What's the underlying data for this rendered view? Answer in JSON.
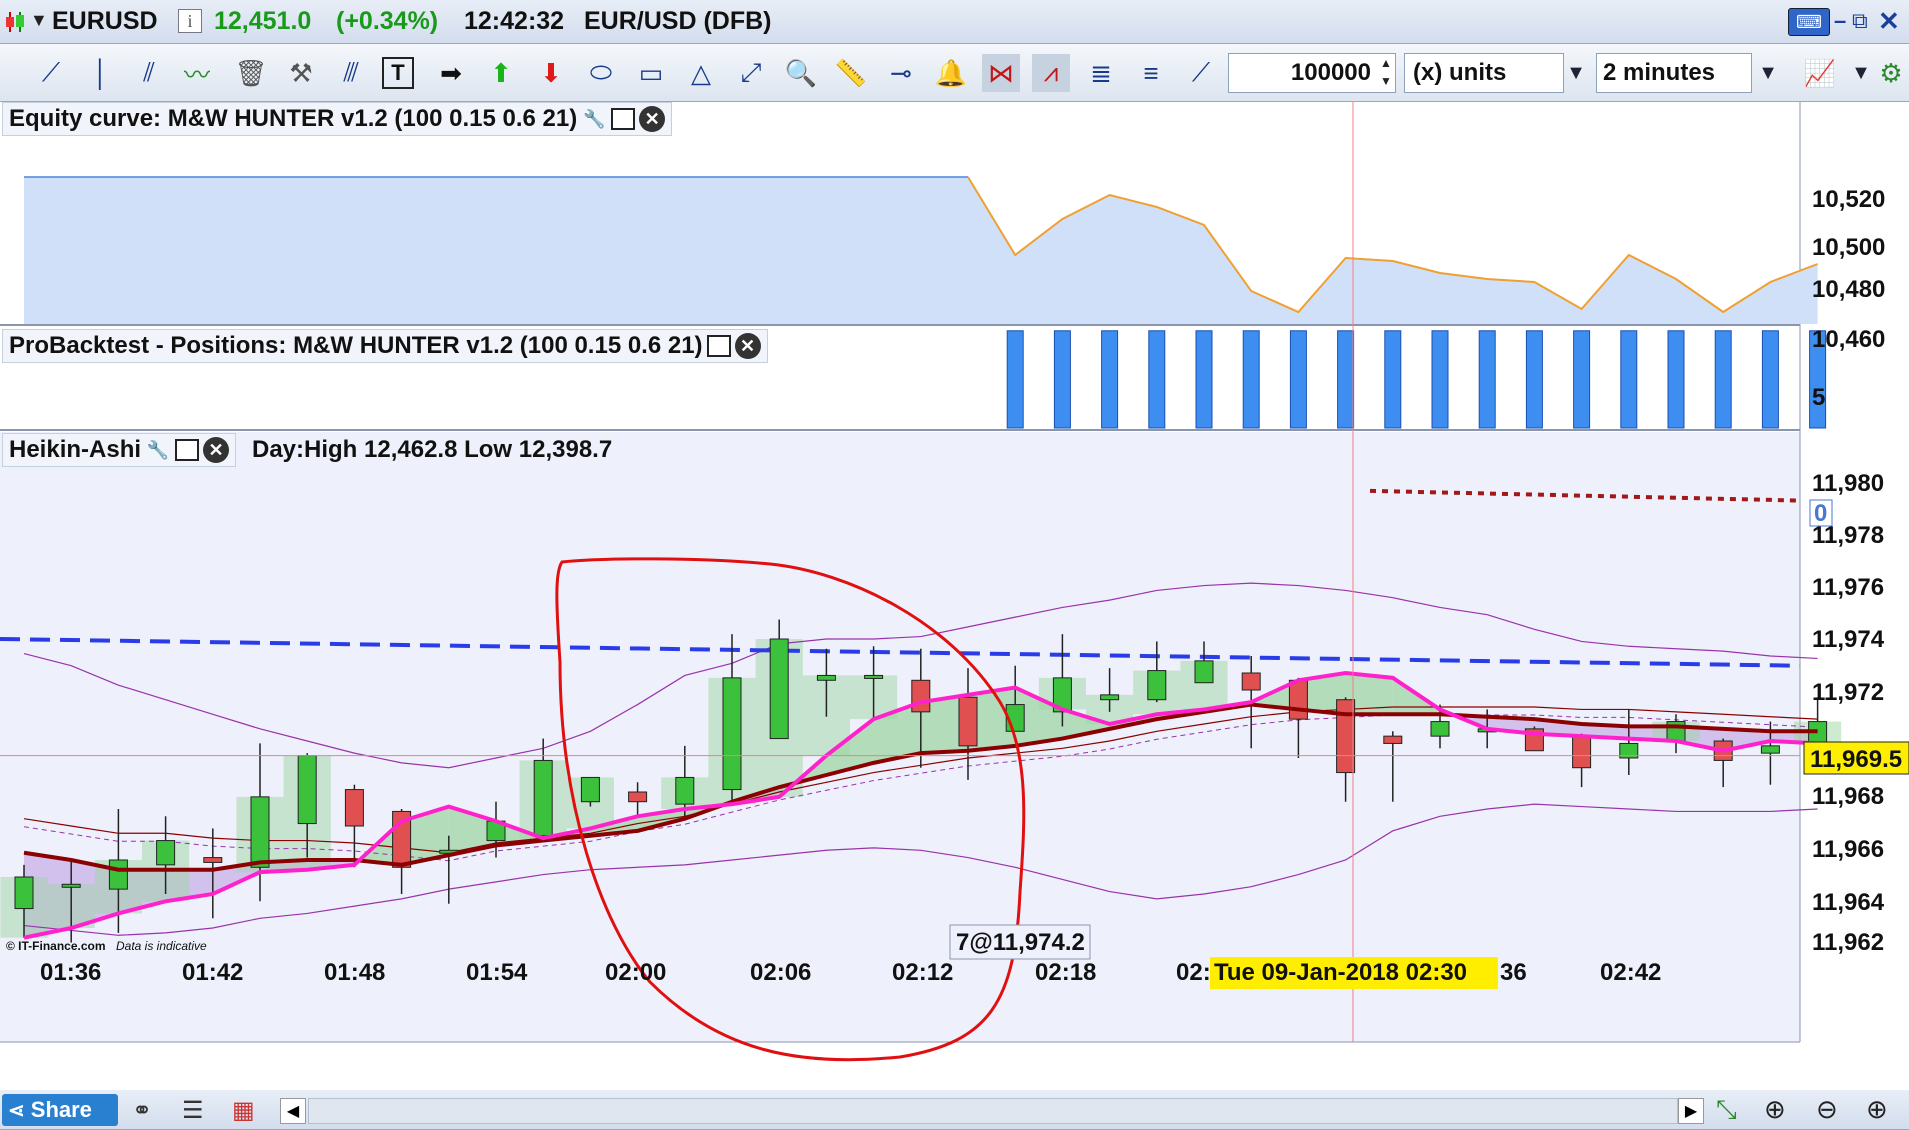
{
  "title_bar": {
    "symbol": "EURUSD",
    "price": "12,451.0",
    "change": "(+0.34%)",
    "time": "12:42:32",
    "instrument": "EUR/USD (DFB)"
  },
  "toolbar": {
    "quantity": "100000",
    "units_label": "(x) units",
    "timeframe": "2 minutes"
  },
  "equity_pane": {
    "title": "Equity curve: M&W HUNTER v1.2 (100 0.15 0.6 21)",
    "y_ticks": [
      "10,520",
      "10,500",
      "10,480",
      "10,460"
    ]
  },
  "positions_pane": {
    "title": "ProBacktest - Positions: M&W HUNTER v1.2 (100 0.15 0.6 21)",
    "y_ticks": [
      "5",
      "0"
    ]
  },
  "price_pane": {
    "title": "Heikin-Ashi",
    "day_range": "Day:High 12,462.8 Low 12,398.7",
    "y_ticks": [
      "11,980",
      "11,978",
      "11,976",
      "11,974",
      "11,972",
      "11,968",
      "11,966",
      "11,964",
      "11,962"
    ],
    "current_price_label": "11,969.5",
    "position_label": "7@11,974.2",
    "watermark": "© IT-Finance.com",
    "disclaimer": "Data is indicative"
  },
  "x_axis": {
    "ticks": [
      "01:36",
      "01:42",
      "01:48",
      "01:54",
      "02:00",
      "02:06",
      "02:12",
      "02:18",
      "02:"
    ],
    "ticks_right": [
      "36",
      "02:42"
    ],
    "cursor_label": "Tue 09-Jan-2018 02:30"
  },
  "bottom_bar": {
    "share_label": "Share"
  },
  "colors": {
    "bull": "#3cc13c",
    "bear": "#e05050",
    "pink_ma": "#ff22cc",
    "darkred_ma": "#8b0000",
    "blue_dash": "#2a3ce8",
    "bollinger": "#9933aa",
    "annotation": "#e01010",
    "cursor_bg": "#ffee00"
  },
  "chart_data": [
    {
      "type": "area",
      "name": "equity",
      "title": "Equity curve: M&W HUNTER v1.2 (100 0.15 0.6 21)",
      "ylim": [
        10451,
        10525
      ],
      "values": [
        10500,
        10500,
        10500,
        10500,
        10500,
        10500,
        10500,
        10500,
        10500,
        10500,
        10500,
        10500,
        10500,
        10500,
        10500,
        10500,
        10500,
        10500,
        10500,
        10500,
        10500,
        10474,
        10486,
        10494,
        10490,
        10484,
        10462,
        10455,
        10473,
        10472,
        10468,
        10466,
        10465,
        10456,
        10474,
        10466,
        10455,
        10465,
        10471
      ]
    },
    {
      "type": "bar",
      "name": "positions",
      "title": "ProBacktest - Positions: M&W HUNTER v1.2 (100 0.15 0.6 21)",
      "ylim": [
        0,
        7.2
      ],
      "start_index": 21,
      "values": [
        7,
        7,
        7,
        7,
        7,
        7,
        7,
        7,
        7,
        7,
        7,
        7,
        7,
        7,
        7,
        7,
        7,
        7
      ]
    },
    {
      "type": "candlestick",
      "name": "Heikin-Ashi",
      "ylim": [
        11961.0,
        11982.0
      ],
      "candles": [
        {
          "o": 11963.2,
          "h": 11965.0,
          "l": 11962.0,
          "c": 11964.5
        },
        {
          "o": 11964.2,
          "h": 11965.2,
          "l": 11961.8,
          "c": 11964.2
        },
        {
          "o": 11964.0,
          "h": 11967.3,
          "l": 11962.2,
          "c": 11965.2
        },
        {
          "o": 11965.0,
          "h": 11967.0,
          "l": 11963.8,
          "c": 11966.0
        },
        {
          "o": 11965.3,
          "h": 11966.5,
          "l": 11962.8,
          "c": 11965.1
        },
        {
          "o": 11964.9,
          "h": 11970.0,
          "l": 11963.5,
          "c": 11967.8
        },
        {
          "o": 11966.7,
          "h": 11969.6,
          "l": 11965.3,
          "c": 11969.5
        },
        {
          "o": 11968.1,
          "h": 11968.3,
          "l": 11964.9,
          "c": 11966.6
        },
        {
          "o": 11967.2,
          "h": 11967.3,
          "l": 11963.8,
          "c": 11964.9
        },
        {
          "o": 11965.5,
          "h": 11966.2,
          "l": 11963.4,
          "c": 11965.6
        },
        {
          "o": 11966.0,
          "h": 11967.6,
          "l": 11965.3,
          "c": 11966.8
        },
        {
          "o": 11966.2,
          "h": 11970.2,
          "l": 11966.2,
          "c": 11969.3
        },
        {
          "o": 11967.6,
          "h": 11968.6,
          "l": 11967.4,
          "c": 11968.6
        },
        {
          "o": 11968.0,
          "h": 11968.4,
          "l": 11967.0,
          "c": 11967.6
        },
        {
          "o": 11967.5,
          "h": 11969.9,
          "l": 11967.0,
          "c": 11968.6
        },
        {
          "o": 11968.1,
          "h": 11974.5,
          "l": 11967.6,
          "c": 11972.7
        },
        {
          "o": 11970.2,
          "h": 11975.1,
          "l": 11970.2,
          "c": 11974.3
        },
        {
          "o": 11972.6,
          "h": 11973.9,
          "l": 11971.1,
          "c": 11972.8
        },
        {
          "o": 11972.8,
          "h": 11974.0,
          "l": 11971.0,
          "c": 11972.8
        },
        {
          "o": 11972.6,
          "h": 11973.9,
          "l": 11969.0,
          "c": 11971.3
        },
        {
          "o": 11971.9,
          "h": 11973.1,
          "l": 11968.5,
          "c": 11969.9
        },
        {
          "o": 11970.5,
          "h": 11973.2,
          "l": 11970.6,
          "c": 11971.6
        },
        {
          "o": 11971.3,
          "h": 11974.5,
          "l": 11970.7,
          "c": 11972.7
        },
        {
          "o": 11971.8,
          "h": 11973.1,
          "l": 11971.3,
          "c": 11972.0
        },
        {
          "o": 11971.8,
          "h": 11974.2,
          "l": 11971.7,
          "c": 11973.0
        },
        {
          "o": 11972.5,
          "h": 11974.2,
          "l": 11972.5,
          "c": 11973.4
        },
        {
          "o": 11972.9,
          "h": 11973.6,
          "l": 11969.8,
          "c": 11972.2
        },
        {
          "o": 11972.6,
          "h": 11972.7,
          "l": 11969.4,
          "c": 11971.0
        },
        {
          "o": 11971.8,
          "h": 11971.9,
          "l": 11967.6,
          "c": 11968.8
        },
        {
          "o": 11970.3,
          "h": 11970.5,
          "l": 11967.6,
          "c": 11970.0
        },
        {
          "o": 11970.3,
          "h": 11971.6,
          "l": 11969.8,
          "c": 11970.9
        },
        {
          "o": 11970.5,
          "h": 11971.4,
          "l": 11969.8,
          "c": 11970.6
        },
        {
          "o": 11970.6,
          "h": 11970.7,
          "l": 11969.7,
          "c": 11969.7
        },
        {
          "o": 11970.3,
          "h": 11970.4,
          "l": 11968.2,
          "c": 11969.0
        },
        {
          "o": 11969.4,
          "h": 11971.4,
          "l": 11968.7,
          "c": 11970.0
        },
        {
          "o": 11970.1,
          "h": 11971.2,
          "l": 11969.6,
          "c": 11970.9
        },
        {
          "o": 11970.1,
          "h": 11970.2,
          "l": 11968.2,
          "c": 11969.3
        },
        {
          "o": 11969.6,
          "h": 11970.9,
          "l": 11968.3,
          "c": 11969.9
        },
        {
          "o": 11969.8,
          "h": 11971.9,
          "l": 11969.8,
          "c": 11970.9
        }
      ],
      "pink_ma": [
        11962.0,
        11962.4,
        11963.0,
        11963.5,
        11963.8,
        11964.7,
        11964.8,
        11965.0,
        11966.8,
        11967.4,
        11966.8,
        11966.1,
        11966.5,
        11967.0,
        11967.3,
        11967.5,
        11967.8,
        11969.5,
        11971.0,
        11971.7,
        11972.0,
        11972.3,
        11971.4,
        11970.8,
        11971.2,
        11971.4,
        11971.7,
        11972.6,
        11972.9,
        11972.7,
        11971.4,
        11970.6,
        11970.4,
        11970.3,
        11970.2,
        11970.1,
        11969.7,
        11970.1,
        11970.0
      ],
      "darkred_ma": [
        11965.5,
        11965.2,
        11964.8,
        11964.8,
        11964.8,
        11965.1,
        11965.2,
        11965.2,
        11965.0,
        11965.4,
        11965.8,
        11966.0,
        11966.2,
        11966.4,
        11966.9,
        11967.6,
        11968.2,
        11968.7,
        11969.2,
        11969.6,
        11969.7,
        11969.9,
        11970.2,
        11970.6,
        11971.0,
        11971.3,
        11971.6,
        11971.4,
        11971.2,
        11971.2,
        11971.2,
        11971.1,
        11971.0,
        11970.8,
        11970.7,
        11970.7,
        11970.6,
        11970.5,
        11970.5
      ],
      "slow_ma": [
        11966.9,
        11966.6,
        11966.3,
        11966.3,
        11966.1,
        11966.0,
        11966.0,
        11965.9,
        11965.7,
        11965.5,
        11965.9,
        11966.1,
        11966.3,
        11966.7,
        11967.0,
        11967.5,
        11968.0,
        11968.4,
        11968.8,
        11969.1,
        11969.4,
        11969.6,
        11969.8,
        11970.1,
        11970.5,
        11970.8,
        11971.1,
        11971.3,
        11971.4,
        11971.5,
        11971.5,
        11971.5,
        11971.5,
        11971.4,
        11971.4,
        11971.3,
        11971.2,
        11971.1,
        11971.0
      ],
      "boll_upper": [
        11973.7,
        11973.2,
        11972.4,
        11971.8,
        11971.2,
        11970.6,
        11970.1,
        11969.6,
        11969.2,
        11969.0,
        11969.4,
        11969.8,
        11970.5,
        11971.6,
        11972.8,
        11973.3,
        11974.1,
        11974.3,
        11974.3,
        11974.4,
        11974.8,
        11975.2,
        11975.6,
        11975.9,
        11976.3,
        11976.5,
        11976.6,
        11976.5,
        11976.3,
        11976.0,
        11975.6,
        11975.3,
        11974.7,
        11974.2,
        11974.0,
        11973.9,
        11973.8,
        11973.6,
        11973.5
      ],
      "boll_lower": [
        11962.5,
        11962.3,
        11962.1,
        11962.2,
        11962.4,
        11962.8,
        11963.0,
        11963.3,
        11963.6,
        11964.0,
        11964.3,
        11964.6,
        11964.8,
        11964.9,
        11965.0,
        11965.2,
        11965.4,
        11965.6,
        11965.7,
        11965.6,
        11965.3,
        11964.9,
        11964.4,
        11963.9,
        11963.6,
        11963.8,
        11964.1,
        11964.6,
        11965.2,
        11966.4,
        11967.0,
        11967.3,
        11967.5,
        11967.4,
        11967.3,
        11967.2,
        11967.2,
        11967.2,
        11967.3
      ],
      "dashed_blue_line": {
        "start": 11974.3,
        "end": 11973.2
      },
      "dotted_red_line": {
        "start": 11980.4,
        "end": 11980.0
      },
      "current_price": 11969.5
    }
  ]
}
